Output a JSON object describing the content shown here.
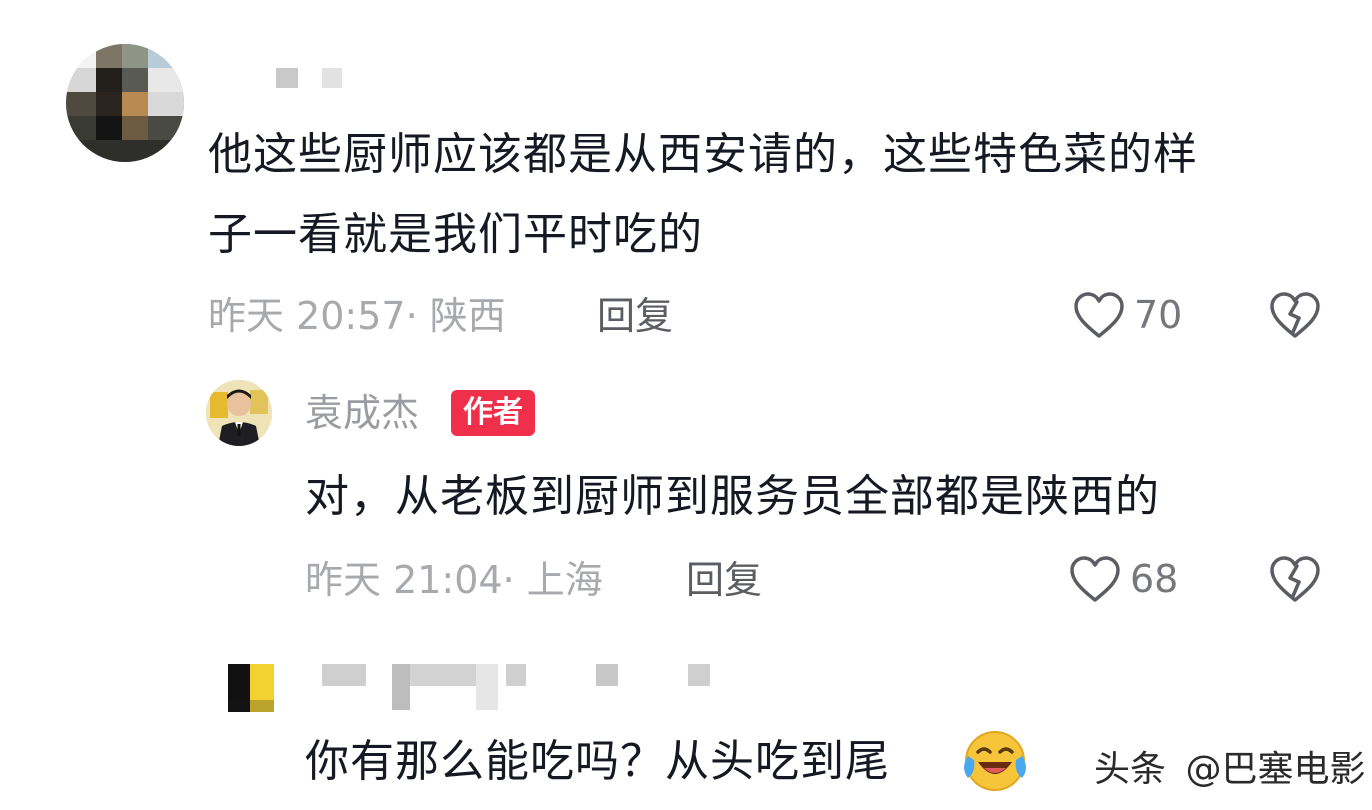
{
  "comments": [
    {
      "text_line1": "他这些厨师应该都是从西安请的，这些特色菜的样",
      "text_line2": "子一看就是我们平时吃的",
      "meta": "昨天 20:57· 陕西",
      "reply_label": "回复",
      "likes": "70"
    },
    {
      "author_name": "袁成杰",
      "author_badge": "作者",
      "text": "对，从老板到厨师到服务员全部都是陕西的",
      "meta": "昨天 21:04· 上海",
      "reply_label": "回复",
      "likes": "68"
    },
    {
      "text": "你有那么能吃吗？从头吃到尾",
      "emoji": "laughing-crying-emoji"
    }
  ],
  "watermark": {
    "brand": "头条",
    "account": "@巴塞电影"
  },
  "colors": {
    "text": "#161823",
    "meta": "#a7a9ad",
    "badge": "#f0304b"
  }
}
